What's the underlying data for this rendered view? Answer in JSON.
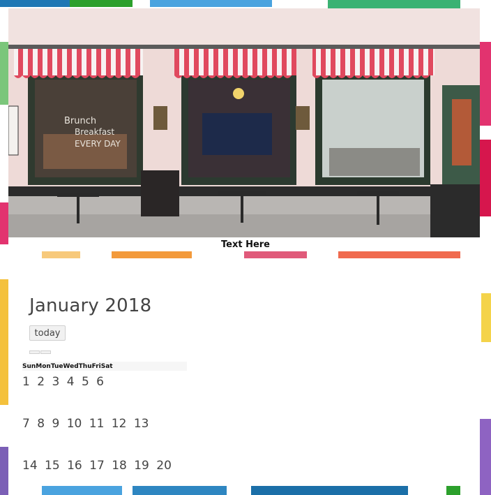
{
  "caption": "Text Here",
  "calendar": {
    "title": "January 2018",
    "today_label": "today",
    "day_headers": [
      "Sun",
      "Mon",
      "Tue",
      "Wed",
      "Thu",
      "Fri",
      "Sat"
    ],
    "weeks": [
      [
        "1",
        "2",
        "3",
        "4",
        "5",
        "6"
      ],
      [
        "7",
        "8",
        "9",
        "10",
        "11",
        "12",
        "13"
      ],
      [
        "14",
        "15",
        "16",
        "17",
        "18",
        "19",
        "20"
      ]
    ]
  },
  "photo": {
    "signs": [
      "Brunch",
      "Breakfast",
      "EVERY DAY"
    ]
  },
  "colors": {
    "awning_red": "#e0495e",
    "frame_accent_blue": "#1f5fa8",
    "frame_accent_green": "#3bb273",
    "frame_accent_purple": "#7b5fb6",
    "frame_accent_yellow": "#f4c13c",
    "frame_accent_orange": "#f39a3b",
    "frame_accent_pink": "#e2336f"
  }
}
